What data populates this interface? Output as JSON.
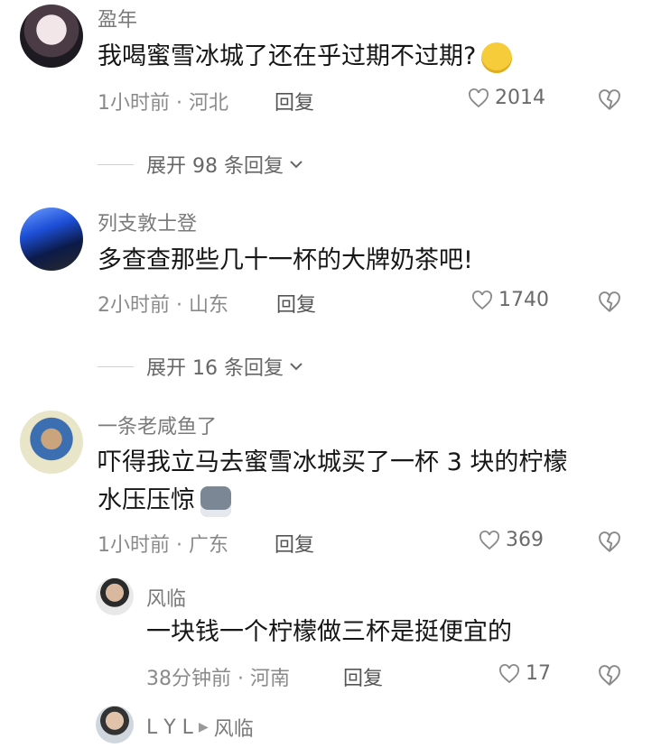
{
  "comments": [
    {
      "name": "盈年",
      "text": "我喝蜜雪冰城了还在乎过期不过期?",
      "emoji": "praying-emoji",
      "time_location": "1小时前 · 河北",
      "reply_label": "回复",
      "likes": "2014",
      "expand_label": "展开 98 条回复"
    },
    {
      "name": "列支敦士登",
      "text": "多查查那些几十一杯的大牌奶茶吧!",
      "time_location": "2小时前 · 山东",
      "reply_label": "回复",
      "likes": "1740",
      "expand_label": "展开 16 条回复"
    },
    {
      "name": "一条老咸鱼了",
      "text_line1": "吓得我立马去蜜雪冰城买了一杯 3 块的柠檬",
      "text_line2": "水压压惊",
      "emoji": "husky-emoji",
      "time_location": "1小时前 · 广东",
      "reply_label": "回复",
      "likes": "369"
    }
  ],
  "replies": [
    {
      "name": "风临",
      "text": "一块钱一个柠檬做三杯是挺便宜的",
      "time_location": "38分钟前 · 河南",
      "reply_label": "回复",
      "likes": "17"
    },
    {
      "name": "L Y L",
      "reply_to": "风临"
    }
  ],
  "colors": {
    "meta": "#8a8a8a",
    "text": "#161616",
    "icon": "#9a9a9a"
  }
}
